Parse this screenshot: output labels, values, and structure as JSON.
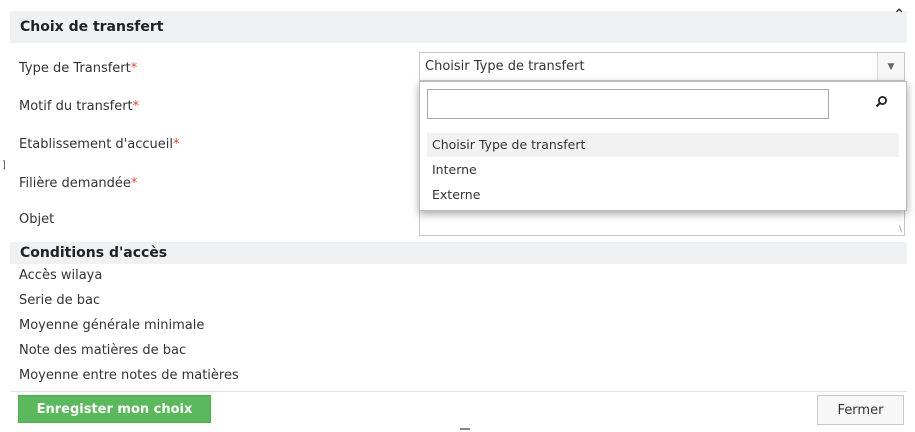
{
  "section": {
    "title": "Choix de transfert"
  },
  "form": {
    "required_marker": "*",
    "type_transfert_label": "Type de Transfert",
    "motif_label": "Motif du transfert",
    "etablissement_label": "Etablissement d'accueil",
    "filiere_label": "Filière demandée",
    "objet_label": "Objet",
    "type_transfert_value": "Choisir Type de transfert",
    "objet_value": ""
  },
  "dropdown": {
    "search_value": "",
    "options": [
      {
        "label": "Choisir Type de transfert",
        "selected": true
      },
      {
        "label": "Interne",
        "selected": false
      },
      {
        "label": "Externe",
        "selected": false
      }
    ]
  },
  "conditions": {
    "title": "Conditions d'accès",
    "items": [
      "Accès wilaya",
      "Serie de bac",
      "Moyenne générale minimale",
      "Note des matières de bac",
      "Moyenne entre notes de matières"
    ]
  },
  "footer": {
    "save_label": "Enregister mon choix",
    "close_label": "Fermer"
  },
  "colors": {
    "save_button": "#5cb85c",
    "required_star": "#e0463a",
    "header_bg": "#f0f1f3"
  },
  "icons": {
    "collapse": "chevron-up-icon",
    "select_arrow": "triangle-down-icon",
    "search": "magnifier-icon",
    "resize": "textarea-resize-icon"
  }
}
